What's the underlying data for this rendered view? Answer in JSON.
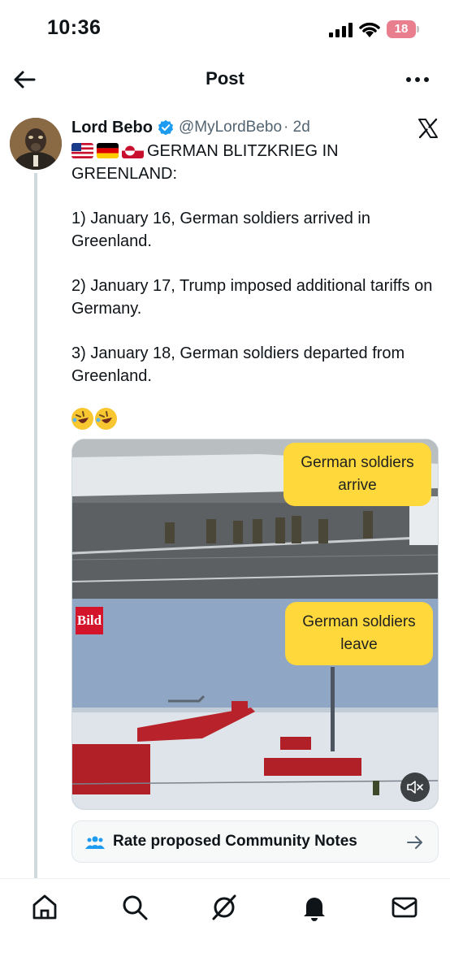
{
  "status_bar": {
    "time": "10:36",
    "battery": "18"
  },
  "header": {
    "title": "Post",
    "back_icon": "arrow-left-icon",
    "more_icon": "more-horizontal-icon"
  },
  "post": {
    "author": {
      "name": "Lord Bebo",
      "handle": "@MyLordBebo",
      "time": "· 2d",
      "verified": true
    },
    "flags": [
      "us-flag",
      "germany-flag",
      "greenland-flag"
    ],
    "lines": [
      "GERMAN BLITZKRIEG IN GREENLAND:",
      "1) January 16, German soldiers arrived in Greenland.",
      "2) January 17, Trump imposed additional tariffs on Germany.",
      "3) January 18, German soldiers departed from Greenland."
    ],
    "emojis": [
      "rolling-on-floor-laughing-emoji",
      "rolling-on-floor-laughing-emoji"
    ],
    "media": {
      "caption_top": "German soldiers arrive",
      "caption_bottom": "German soldiers leave",
      "watermark": "Bild"
    }
  },
  "community_notes": {
    "label": "Rate proposed Community Notes"
  },
  "bottom_nav": [
    "home-icon",
    "search-icon",
    "grok-icon",
    "notifications-icon",
    "messages-icon"
  ],
  "colors": {
    "verified": "#1d9bf0",
    "caption": "#ffd83b",
    "accent": "#1d9bf0"
  }
}
